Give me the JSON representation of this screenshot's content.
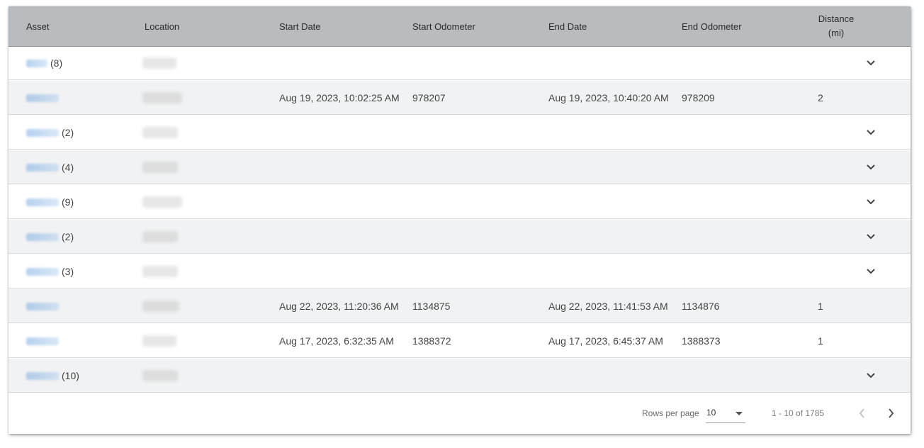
{
  "table": {
    "columns": {
      "asset": "Asset",
      "location": "Location",
      "start_date": "Start Date",
      "start_odometer": "Start Odometer",
      "end_date": "End Date",
      "end_odometer": "End Odometer",
      "distance_line1": "Distance",
      "distance_line2": "(mi)"
    },
    "rows": [
      {
        "count": "(8)",
        "start_date": "",
        "start_odometer": "",
        "end_date": "",
        "end_odometer": "",
        "distance": "",
        "expandable": true
      },
      {
        "count": "",
        "start_date": "Aug 19, 2023, 10:02:25 AM",
        "start_odometer": "978207",
        "end_date": "Aug 19, 2023, 10:40:20 AM",
        "end_odometer": "978209",
        "distance": "2",
        "expandable": false
      },
      {
        "count": "(2)",
        "start_date": "",
        "start_odometer": "",
        "end_date": "",
        "end_odometer": "",
        "distance": "",
        "expandable": true
      },
      {
        "count": "(4)",
        "start_date": "",
        "start_odometer": "",
        "end_date": "",
        "end_odometer": "",
        "distance": "",
        "expandable": true
      },
      {
        "count": "(9)",
        "start_date": "",
        "start_odometer": "",
        "end_date": "",
        "end_odometer": "",
        "distance": "",
        "expandable": true
      },
      {
        "count": "(2)",
        "start_date": "",
        "start_odometer": "",
        "end_date": "",
        "end_odometer": "",
        "distance": "",
        "expandable": true
      },
      {
        "count": "(3)",
        "start_date": "",
        "start_odometer": "",
        "end_date": "",
        "end_odometer": "",
        "distance": "",
        "expandable": true
      },
      {
        "count": "",
        "start_date": "Aug 22, 2023, 11:20:36 AM",
        "start_odometer": "1134875",
        "end_date": "Aug 22, 2023, 11:41:53 AM",
        "end_odometer": "1134876",
        "distance": "1",
        "expandable": false
      },
      {
        "count": "",
        "start_date": "Aug 17, 2023, 6:32:35 AM",
        "start_odometer": "1388372",
        "end_date": "Aug 17, 2023, 6:45:37 AM",
        "end_odometer": "1388373",
        "distance": "1",
        "expandable": false
      },
      {
        "count": "(10)",
        "start_date": "",
        "start_odometer": "",
        "end_date": "",
        "end_odometer": "",
        "distance": "",
        "expandable": true
      }
    ]
  },
  "pagination": {
    "rows_per_page_label": "Rows per page",
    "rows_per_page_value": "10",
    "range_text": "1 - 10 of 1785",
    "prev_icon": "chevron-left-icon",
    "next_icon": "chevron-right-icon"
  },
  "colors": {
    "header_bg": "#b8bcbf",
    "alt_row_bg": "#f1f2f3",
    "link_blue": "#78aae1"
  }
}
